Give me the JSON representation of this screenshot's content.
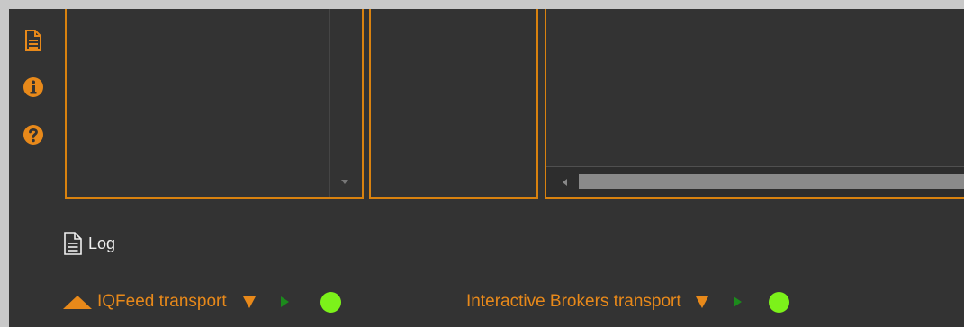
{
  "sidebar": {
    "icons": [
      "document-icon",
      "info-icon",
      "help-icon"
    ]
  },
  "log": {
    "label": "Log"
  },
  "transports": [
    {
      "label": "IQFeed transport",
      "status": "connected"
    },
    {
      "label": "Interactive Brokers transport",
      "status": "connected"
    }
  ],
  "colors": {
    "accent": "#e8891a",
    "panel_border": "#d9820f",
    "background": "#333333",
    "play": "#1c8a1c",
    "status_ok": "#7cf21a"
  }
}
